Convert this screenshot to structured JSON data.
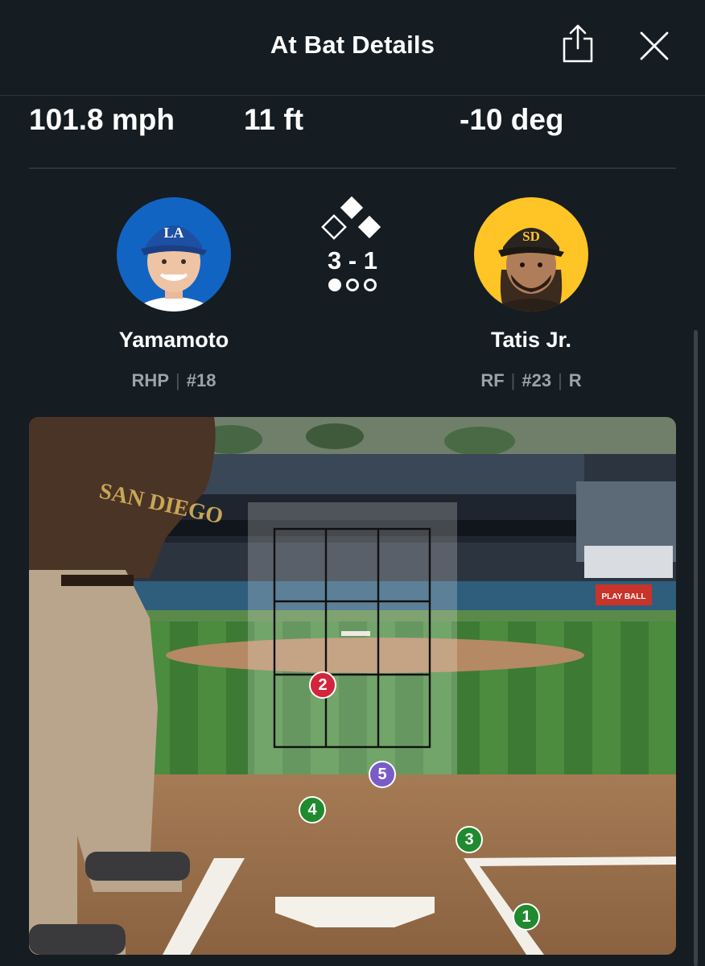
{
  "header": {
    "title": "At Bat Details"
  },
  "stats": [
    {
      "value": "101.8 mph"
    },
    {
      "value": "11 ft"
    },
    {
      "value": "-10 deg"
    }
  ],
  "pitcher": {
    "name": "Yamamoto",
    "throws": "RHP",
    "number": "#18",
    "logo_text": "LA",
    "team_color": "#0a5cb8"
  },
  "batter": {
    "name": "Tatis Jr.",
    "position": "RF",
    "number": "#23",
    "bats": "R",
    "logo_text": "SD",
    "team_color": "#ffc425"
  },
  "game_state": {
    "count": "3 - 1",
    "bases": {
      "first": true,
      "second": true,
      "third": false
    },
    "outs": [
      true,
      false,
      false
    ]
  },
  "pitches": [
    {
      "number": "1",
      "result": "ball",
      "color": "#1f8a2e"
    },
    {
      "number": "2",
      "result": "strike",
      "color": "#d3253b"
    },
    {
      "number": "3",
      "result": "ball",
      "color": "#1f8a2e"
    },
    {
      "number": "4",
      "result": "ball",
      "color": "#1f8a2e"
    },
    {
      "number": "5",
      "result": "in-play",
      "color": "#7a5cc9"
    }
  ],
  "field": {
    "wall_sign": "PLAY BALL",
    "jersey_text": "SAN DIEGO"
  }
}
